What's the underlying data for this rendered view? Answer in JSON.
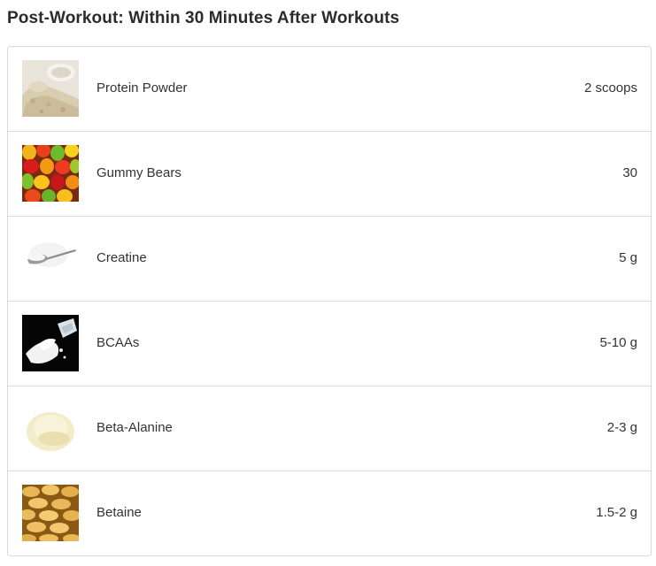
{
  "title": "Post-Workout: Within 30 Minutes After Workouts",
  "items": [
    {
      "name": "Protein Powder",
      "amount": "2 scoops",
      "image": "protein-powder-image"
    },
    {
      "name": "Gummy Bears",
      "amount": "30",
      "image": "gummy-bears-image"
    },
    {
      "name": "Creatine",
      "amount": "5 g",
      "image": "creatine-image"
    },
    {
      "name": "BCAAs",
      "amount": "5-10 g",
      "image": "bcaas-image"
    },
    {
      "name": "Beta-Alanine",
      "amount": "2-3 g",
      "image": "beta-alanine-image"
    },
    {
      "name": "Betaine",
      "amount": "1.5-2 g",
      "image": "betaine-image"
    }
  ]
}
